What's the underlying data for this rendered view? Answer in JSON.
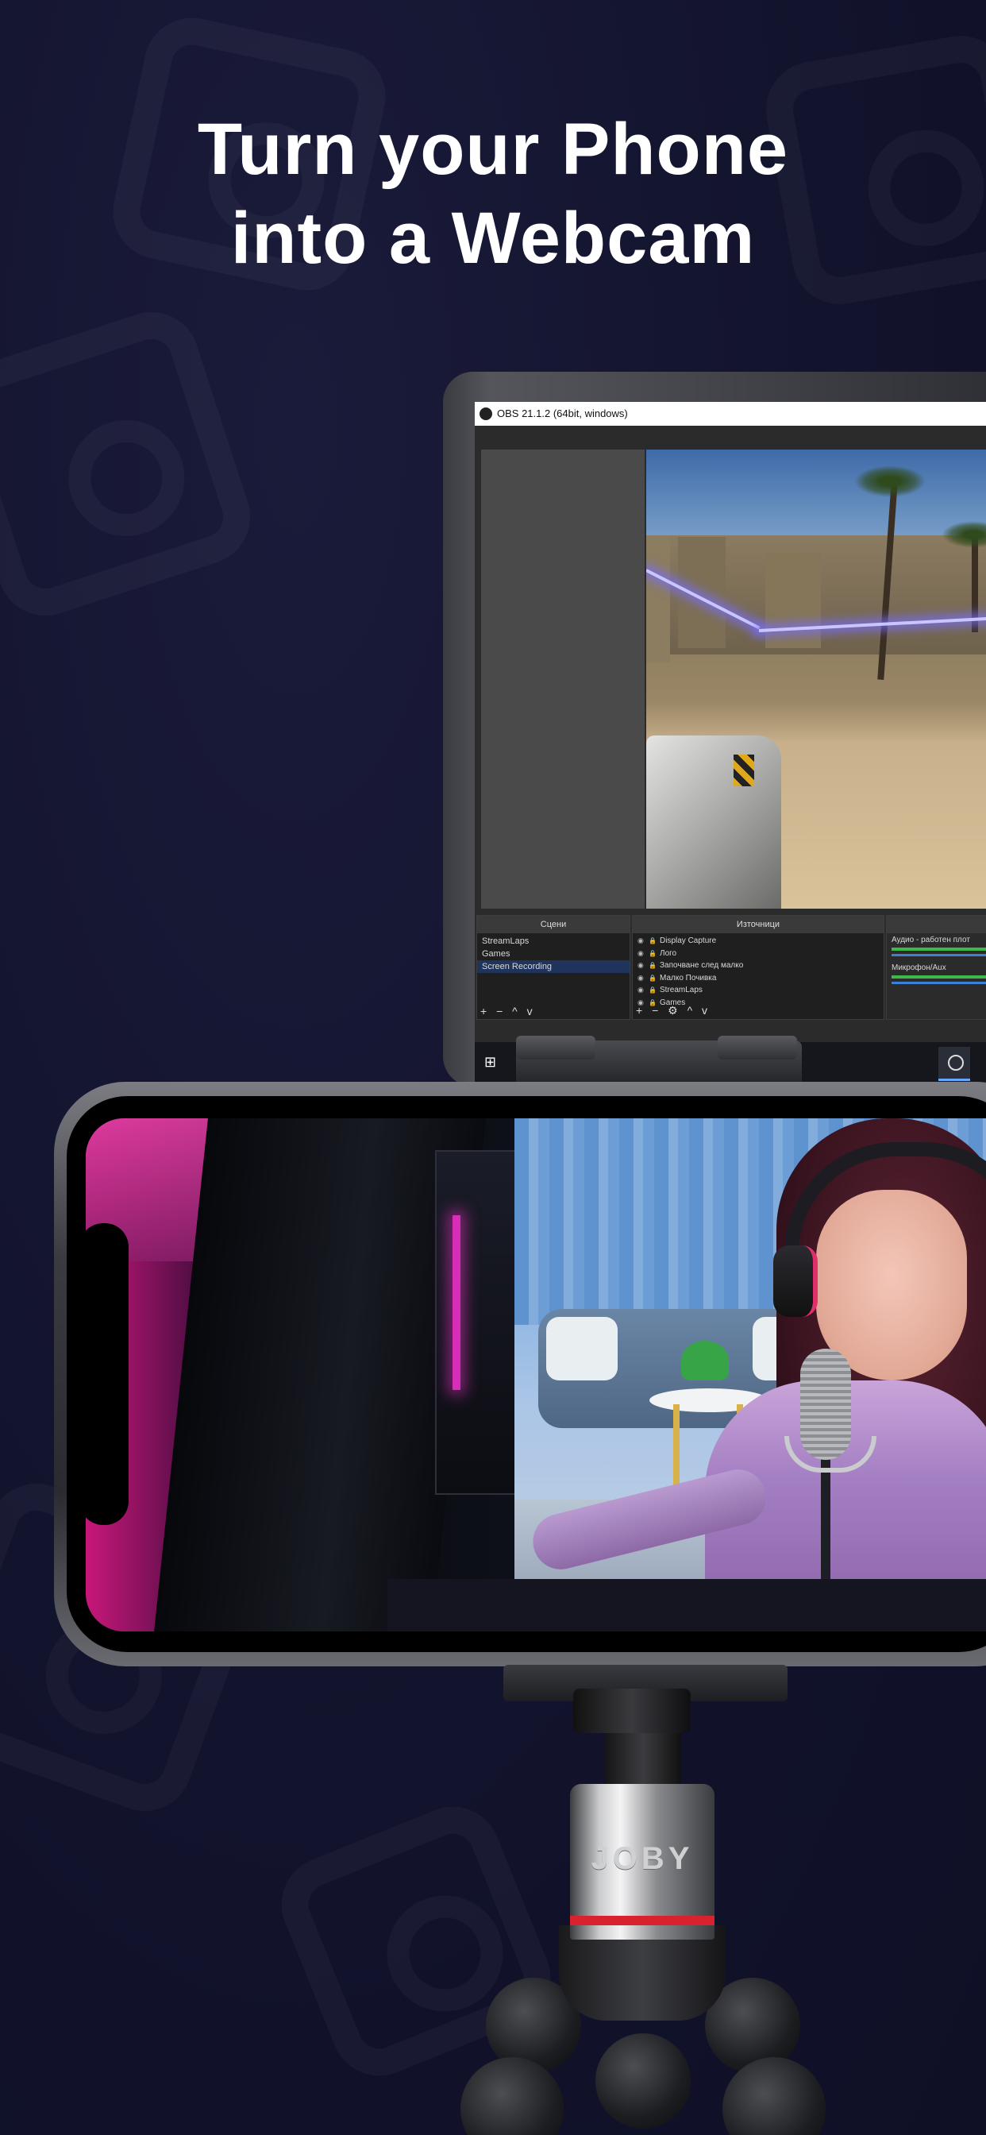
{
  "headline": {
    "line1": "Turn your Phone",
    "line2": "into a Webcam"
  },
  "obs": {
    "window_title": "OBS 21.1.2 (64bit, windows)",
    "scenes_header": "Сцени",
    "scenes": [
      "StreamLaps",
      "Games",
      "Screen Recording"
    ],
    "selected_scene_index": 2,
    "sources_header": "Източници",
    "sources": [
      "Display Capture",
      "Лого",
      "Започване след малко",
      "Малко Почивка",
      "StreamLaps",
      "Games"
    ],
    "mixer": {
      "track1": "Аудио - работен плот",
      "track2": "Микрофон/Aux"
    },
    "panel_tools": "+ − ^ v",
    "sources_tools": "+ − ⚙ ^ v"
  },
  "tripod": {
    "brand": "JOBY"
  },
  "colors": {
    "background": "#12132c",
    "headline": "#ffffff",
    "obs_selection": "#20335a",
    "tripod_ring": "#d8222e"
  },
  "icons": [
    "windows-logo-icon",
    "obs-logo-icon",
    "eye-icon",
    "lock-icon"
  ]
}
